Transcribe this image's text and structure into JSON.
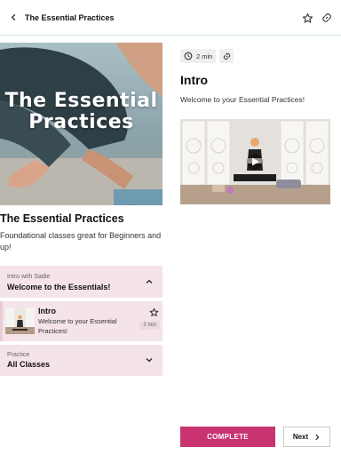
{
  "header": {
    "title": "The Essential Practices",
    "icons": {
      "back": "chevron-left-icon",
      "favorite": "star-outline-icon",
      "share": "link-icon"
    }
  },
  "course": {
    "hero_text": "The Essential Practices",
    "title": "The Essential Practices",
    "description": "Foundational classes great for Beginners and up!"
  },
  "sections": [
    {
      "subtitle": "Intro with Sadie",
      "title": "Welcome to the Essentials!",
      "expanded": true
    },
    {
      "subtitle": "Practice",
      "title": "All Classes",
      "expanded": false
    }
  ],
  "lesson_item": {
    "title": "Intro",
    "description": "Welcome to your Essential Practices!",
    "duration": "2 min"
  },
  "detail": {
    "duration": "2 min",
    "title": "Intro",
    "subtitle": "Welcome to your Essential Practices!"
  },
  "actions": {
    "complete": "COMPLETE",
    "next": "Next"
  },
  "colors": {
    "accent": "#c83370",
    "section_bg": "#f5e3ea",
    "divider": "#cfe3df"
  }
}
